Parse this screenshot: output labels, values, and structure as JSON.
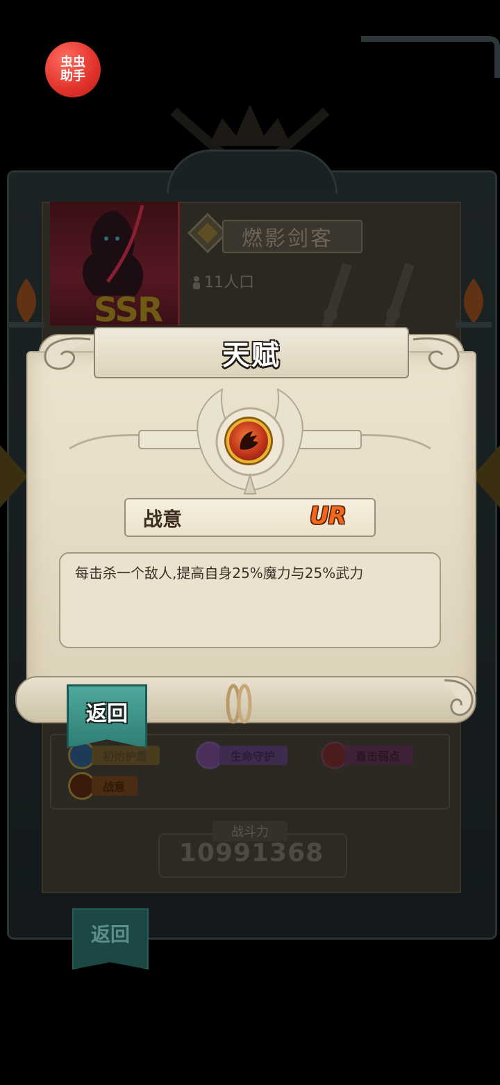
{
  "assistant_badge": {
    "label": "虫虫助手"
  },
  "hero": {
    "name": "燃影剑客",
    "rarity": "SSR",
    "population": "11人口"
  },
  "talents": [
    {
      "label": "初始护盾",
      "color": "#2f6fbf"
    },
    {
      "label": "生命守护",
      "color": "#9b6cc9"
    },
    {
      "label": "直击弱点",
      "color": "#c0392b"
    },
    {
      "label": "战意",
      "color": "#e07a2a"
    }
  ],
  "power": {
    "label": "战斗力",
    "value": "10991368"
  },
  "background_back_label": "返回",
  "dialog": {
    "title": "天赋",
    "skill_name": "战意",
    "skill_rarity": "UR",
    "description": "每击杀一个敌人,提高自身25%魔力与25%武力",
    "back_label": "返回"
  },
  "colors": {
    "parchment": "#e6dcc6",
    "back_button": "#3f9488",
    "rarity_ur": "#f0681c"
  }
}
